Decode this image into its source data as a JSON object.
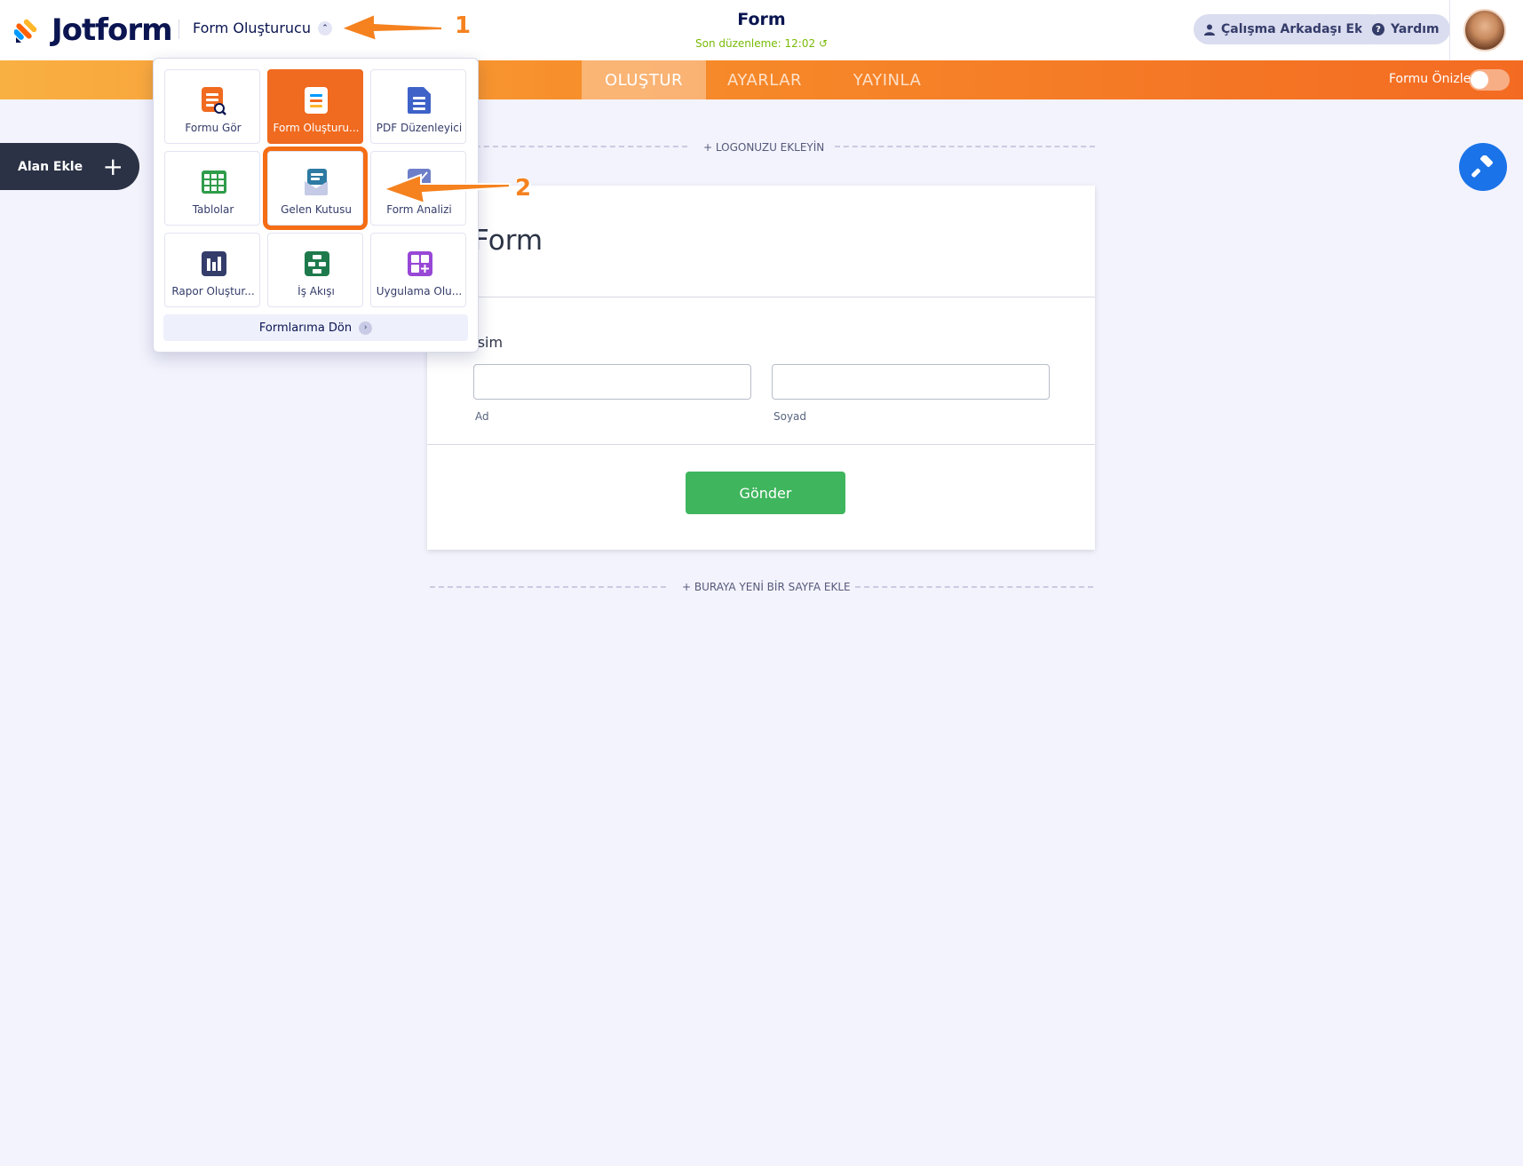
{
  "app": {
    "logo_text": "Jotform",
    "builder_menu_label": "Form Oluşturucu"
  },
  "header": {
    "form_title": "Form",
    "last_edit": "Son düzenleme: 12:02",
    "invite_label": "Çalışma Arkadaşı Ekle",
    "help_label": "Yardım"
  },
  "nav": {
    "tabs": [
      {
        "label": "OLUŞTUR",
        "active": true
      },
      {
        "label": "AYARLAR",
        "active": false
      },
      {
        "label": "YAYINLA",
        "active": false
      }
    ],
    "preview_label": "Formu Önizle",
    "preview_enabled": false
  },
  "sidebar": {
    "add_field_label": "Alan Ekle"
  },
  "canvas": {
    "logo_prompt": "+ LOGONUZU EKLEYİN",
    "add_page_prompt": "+ BURAYA YENİ BİR SAYFA EKLE"
  },
  "form": {
    "heading": "Form",
    "name_label": "İsim",
    "first_sublabel": "Ad",
    "last_sublabel": "Soyad",
    "first_value": "",
    "last_value": "",
    "submit_label": "Gönder"
  },
  "product_menu": {
    "items": [
      {
        "label": "Formu Gör",
        "icon": "form-view-icon"
      },
      {
        "label": "Form Oluşturu...",
        "icon": "form-builder-icon",
        "active": true
      },
      {
        "label": "PDF Düzenleyici",
        "icon": "pdf-editor-icon"
      },
      {
        "label": "Tablolar",
        "icon": "tables-icon"
      },
      {
        "label": "Gelen Kutusu",
        "icon": "inbox-icon",
        "highlighted": true
      },
      {
        "label": "Form Analizi",
        "icon": "analytics-icon"
      },
      {
        "label": "Rapor Oluştur...",
        "icon": "report-builder-icon"
      },
      {
        "label": "İş Akışı",
        "icon": "workflow-icon"
      },
      {
        "label": "Uygulama Olu...",
        "icon": "app-builder-icon"
      }
    ],
    "back_label": "Formlarıma Dön"
  },
  "annotations": {
    "step1": "1",
    "step2": "2"
  },
  "colors": {
    "brand_orange": "#f36b22",
    "navy": "#0a1551",
    "submit_green": "#3fb55d",
    "last_edit_green": "#78bb07",
    "fab_blue": "#1a73e8"
  }
}
